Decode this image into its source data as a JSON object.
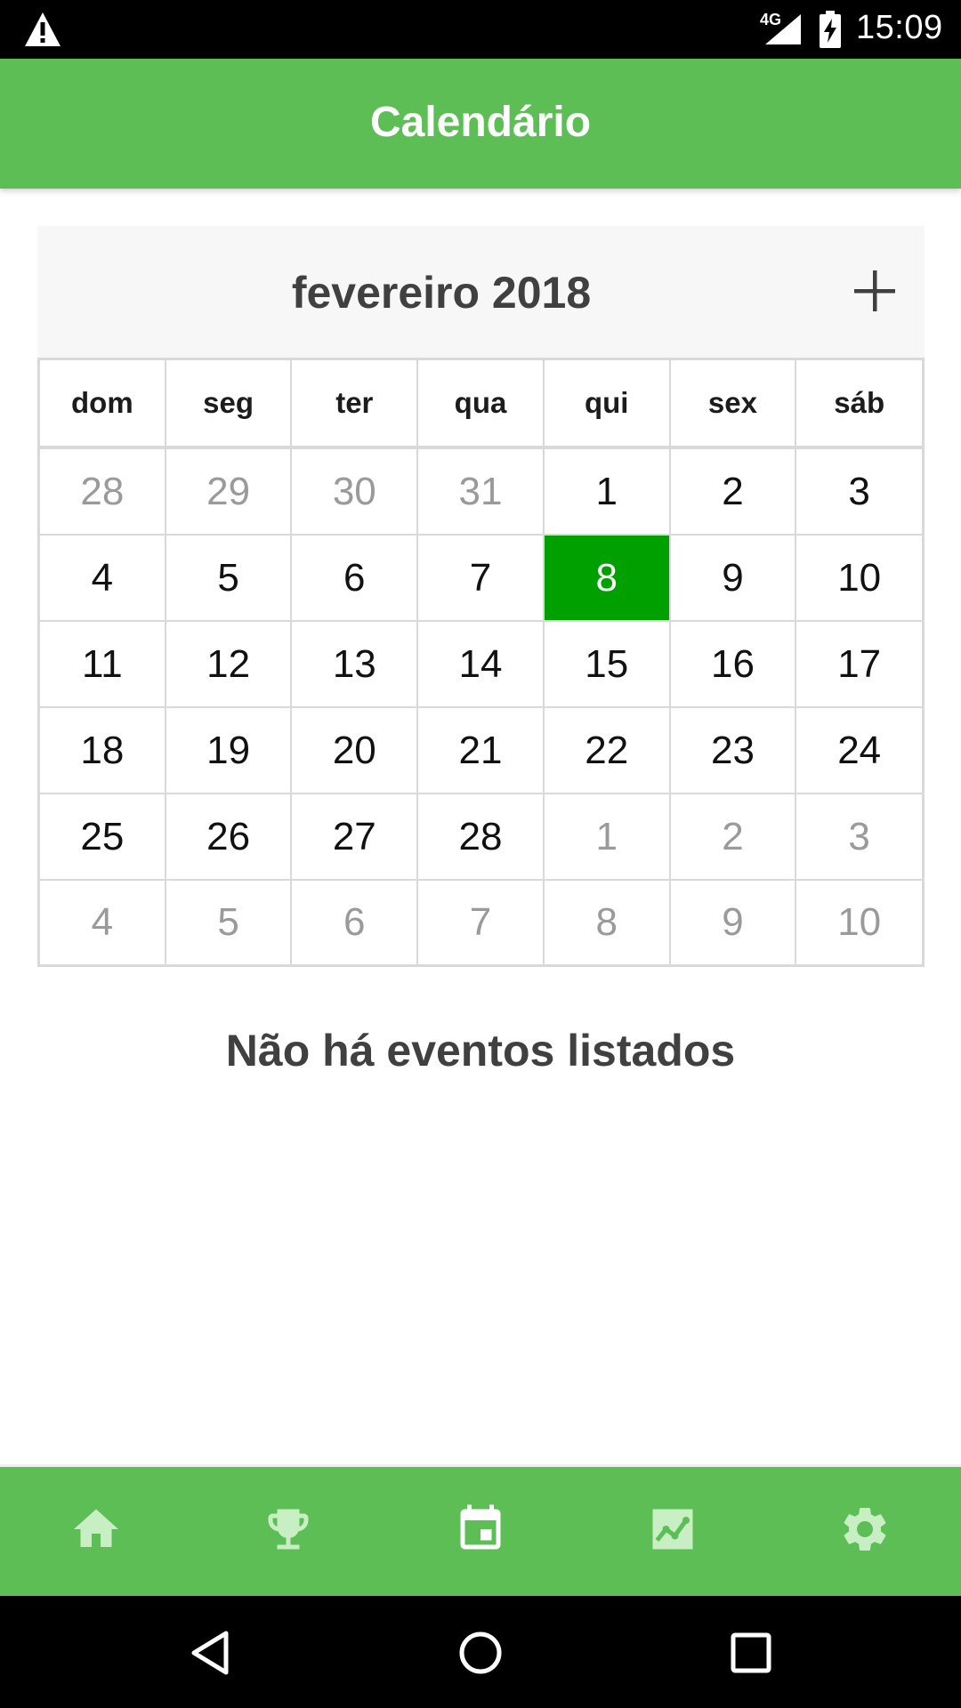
{
  "status_bar": {
    "network_type": "4G",
    "time": "15:09"
  },
  "app_bar": {
    "title": "Calendário"
  },
  "calendar": {
    "month_label": "fevereiro 2018",
    "add_icon": "plus-icon",
    "weekdays": [
      "dom",
      "seg",
      "ter",
      "qua",
      "qui",
      "sex",
      "sáb"
    ],
    "weeks": [
      [
        "28",
        "29",
        "30",
        "31",
        "1",
        "2",
        "3"
      ],
      [
        "4",
        "5",
        "6",
        "7",
        "8",
        "9",
        "10"
      ],
      [
        "11",
        "12",
        "13",
        "14",
        "15",
        "16",
        "17"
      ],
      [
        "18",
        "19",
        "20",
        "21",
        "22",
        "23",
        "24"
      ],
      [
        "25",
        "26",
        "27",
        "28",
        "1",
        "2",
        "3"
      ],
      [
        "4",
        "5",
        "6",
        "7",
        "8",
        "9",
        "10"
      ]
    ],
    "selected_day": "8",
    "colors": {
      "selected": "#00a000",
      "muted_text": "#9a9a9a"
    }
  },
  "events": {
    "empty_message": "Não há eventos listados"
  },
  "bottom_nav": {
    "items": [
      "home-icon",
      "trophy-icon",
      "calendar-icon",
      "chart-icon",
      "gear-icon"
    ],
    "active": "calendar-icon"
  },
  "theme": {
    "primary": "#5cbe55",
    "icon_tint": "#c8efc4",
    "active_icon": "#ffffff"
  },
  "system_nav": {
    "items": [
      "back-icon",
      "home-circle-icon",
      "recents-icon"
    ]
  }
}
